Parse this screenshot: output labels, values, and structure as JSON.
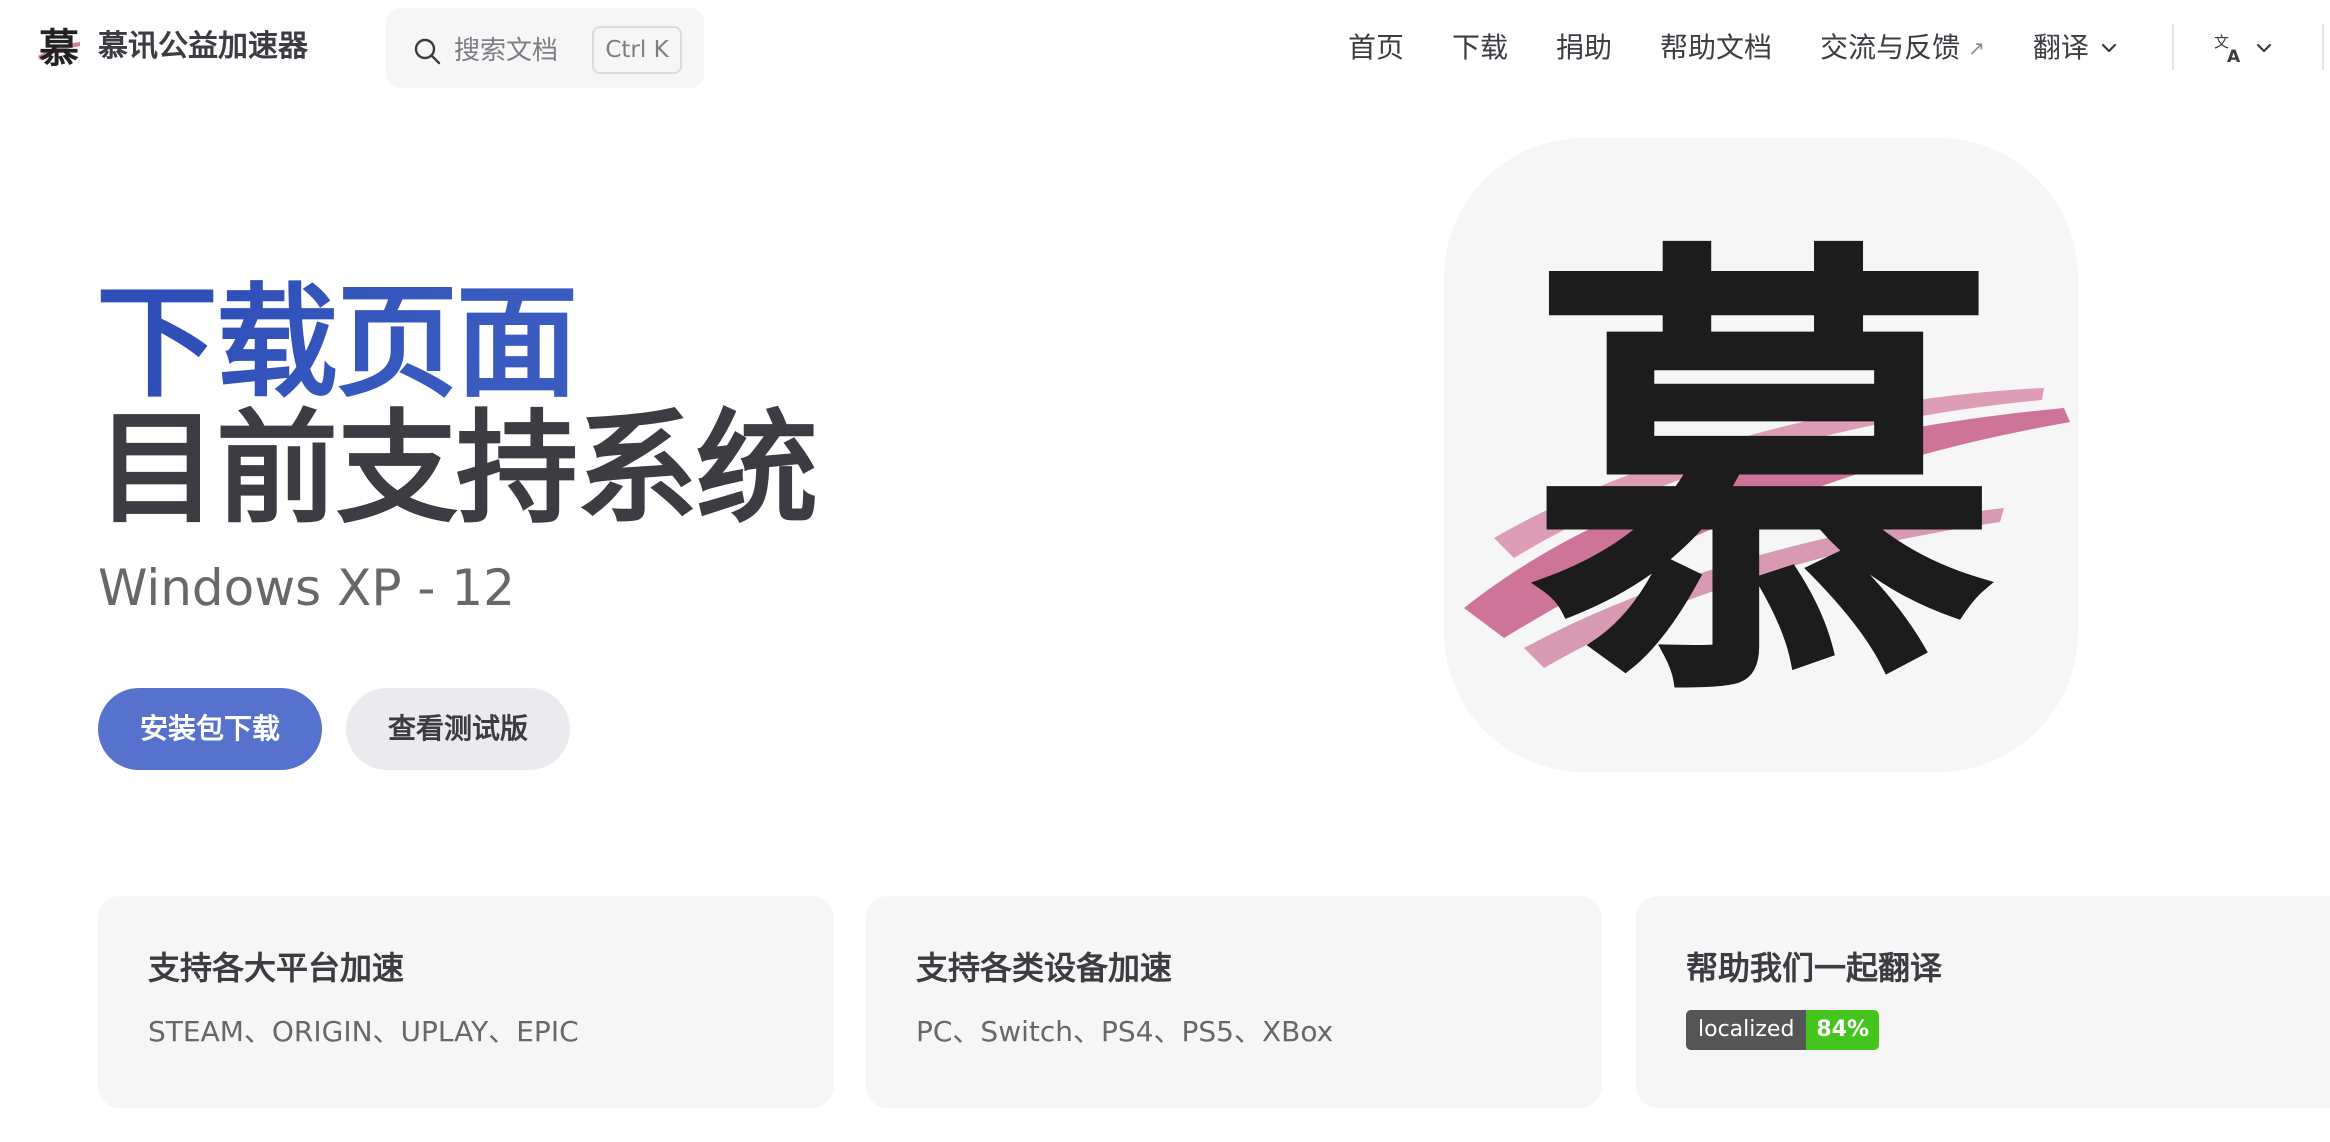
{
  "nav": {
    "site_title": "慕讯公益加速器",
    "logo_char": "慕",
    "search": {
      "label": "搜索文档",
      "shortcut": "Ctrl K"
    },
    "links": [
      {
        "label": "首页"
      },
      {
        "label": "下载"
      },
      {
        "label": "捐助"
      },
      {
        "label": "帮助文档"
      },
      {
        "label": "交流与反馈",
        "external_marker": "↗"
      },
      {
        "label": "翻译",
        "has_dropdown": true
      }
    ],
    "language_icon": "translate-icon"
  },
  "hero": {
    "name": "下载页面",
    "text": "目前支持系统",
    "tagline": "Windows XP - 12",
    "actions": [
      {
        "label": "安装包下载",
        "theme": "brand"
      },
      {
        "label": "查看测试版",
        "theme": "alt"
      }
    ],
    "image_char": "慕"
  },
  "features": [
    {
      "title": "支持各大平台加速",
      "details": "STEAM、ORIGIN、UPLAY、EPIC"
    },
    {
      "title": "支持各类设备加速",
      "details": "PC、Switch、PS4、PS5、XBox"
    },
    {
      "title": "帮助我们一起翻译",
      "badge": {
        "label": "localized",
        "value": "84%"
      }
    }
  ],
  "colors": {
    "brand": "#3451b2",
    "brand_button": "#5672cd",
    "text_primary": "#3c3c43",
    "text_secondary": "#67676c",
    "surface": "#f6f6f7",
    "logo_pink": "#c9688f",
    "badge_green": "#44c41c",
    "badge_gray": "#555555"
  }
}
